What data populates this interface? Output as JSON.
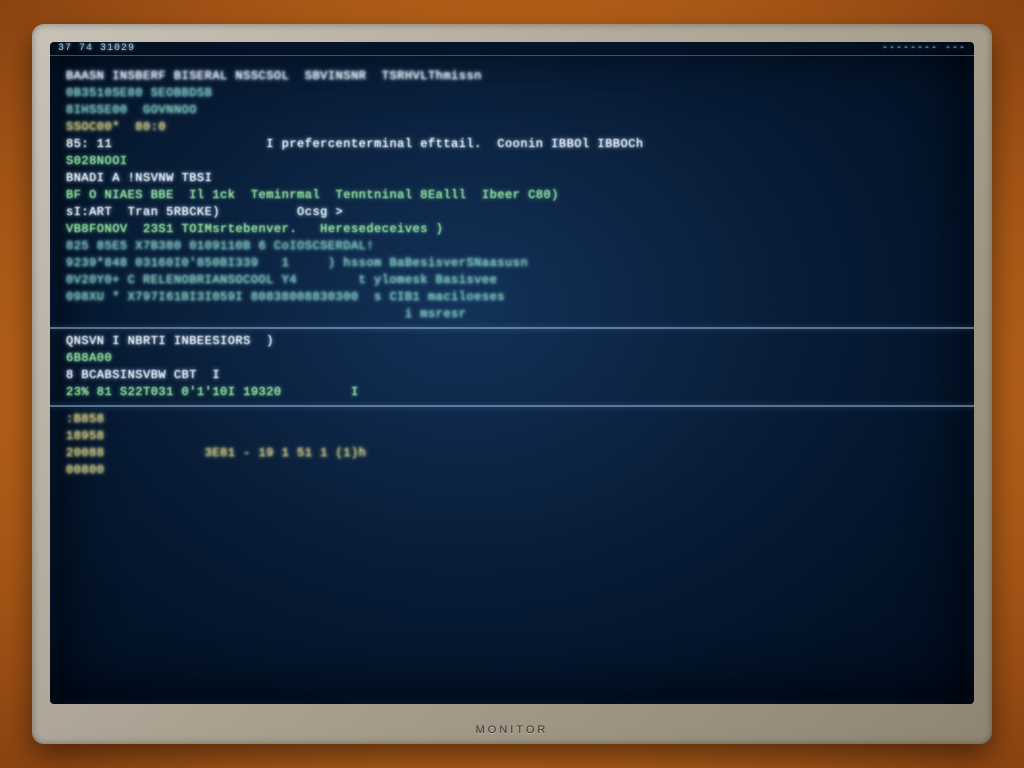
{
  "monitor": {
    "brand": "MONITOR"
  },
  "topbar": {
    "left": "37 74 31029",
    "right": "--------  ---"
  },
  "terminal": {
    "lines": [
      {
        "cls": "c-white blur-more",
        "text": "BAASN INSBERF BISERAL NSSCSOL  SBVINSNR  TSRHVLThmissn"
      },
      {
        "cls": "c-teal  blur-more",
        "text": "0B3510SE80 SEOBBDSB"
      },
      {
        "cls": "c-teal  blur-more",
        "text": "8IHSSE00  GOVNNOO"
      },
      {
        "cls": "c-yel   blur-more",
        "text": "SSOC00*  80:0"
      },
      {
        "cls": "c-dim",
        "text": ""
      },
      {
        "cls": "c-white",
        "text": "85: 11                    I prefercenterminal efttail.  Coonin IBBOl IBBOCh"
      },
      {
        "cls": "c-green",
        "text": "S028NOOI"
      },
      {
        "cls": "c-dim",
        "text": ""
      },
      {
        "cls": "c-white",
        "text": "BNADI A !NSVNW TBSI"
      },
      {
        "cls": "c-green",
        "text": "BF O NIAES BBE  Il 1ck  Teminrmal  Tenntninal 8Ealll  Ibeer C80)"
      },
      {
        "cls": "c-dim",
        "text": ""
      },
      {
        "cls": "c-white",
        "text": "sI:ART  Tran 5RBCKE)          Ocsg >"
      },
      {
        "cls": "c-green",
        "text": "VB8FONOV  23S1 TOIMsrtebenver.   Heresedeceives )"
      },
      {
        "cls": "c-dim",
        "text": ""
      },
      {
        "cls": "c-teal  blur-more",
        "text": "825 85E5 X7B380 0109110B 6 CoIOSCSERDAL!"
      },
      {
        "cls": "c-teal  blur-more",
        "text": "9239*848 03160I0'850BI339   1     ) hssom BaBesisverSNaasusn"
      },
      {
        "cls": "c-teal  blur-more",
        "text": "0V20Y0+ C RELENOBRIANSOCOOL Y4        t ylomesk Basisvee"
      },
      {
        "cls": "c-teal  blur-more",
        "text": "098XU * X797I61BI3I059I 80838008830300  s CIB1 maciloeses"
      },
      {
        "cls": "c-teal  blur-more",
        "text": "                                            i msresr"
      }
    ],
    "lines2": [
      {
        "cls": "c-white",
        "text": "QNSVN I NBRTI INBEESIORS  )"
      },
      {
        "cls": "c-green",
        "text": "6B8A00"
      },
      {
        "cls": "c-white",
        "text": "8 BCABSINSVBW CBT  I"
      },
      {
        "cls": "c-green",
        "text": "23% 81 S22T031 0'1'10I 19320         I"
      }
    ],
    "lines3": [
      {
        "cls": "c-yel blur-more",
        "text": ":B858"
      },
      {
        "cls": "c-yel blur-more",
        "text": "18958"
      },
      {
        "cls": "c-yel blur-more",
        "text": "20088             3E81 - 19 1 51 1 (1)h"
      },
      {
        "cls": "c-yel blur-more",
        "text": "00800"
      }
    ]
  }
}
